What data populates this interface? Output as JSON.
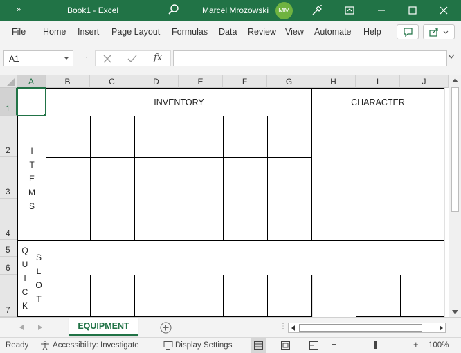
{
  "titlebar": {
    "quick_access": "»",
    "title": "Book1  -  Excel",
    "user_name": "Marcel Mrozowski",
    "user_initials": "MM",
    "bg_color": "#217346"
  },
  "menu": {
    "items": [
      "File",
      "Home",
      "Insert",
      "Page Layout",
      "Formulas",
      "Data",
      "Review",
      "View",
      "Automate",
      "Help"
    ]
  },
  "formula_bar": {
    "name_box": "A1",
    "formula": "",
    "fx": "fx"
  },
  "columns": [
    "A",
    "B",
    "C",
    "D",
    "E",
    "F",
    "G",
    "H",
    "I",
    "J"
  ],
  "rows": [
    "1",
    "2",
    "3",
    "4",
    "5",
    "6",
    "7"
  ],
  "sheet": {
    "inventory_label": "INVENTORY",
    "character_label": "CHARACTER",
    "items_letters": [
      "I",
      "T",
      "E",
      "M",
      "S"
    ],
    "quick_letters": [
      "Q",
      "U",
      "I",
      "C",
      "K"
    ],
    "slot_letters": [
      "S",
      "L",
      "O",
      "T"
    ]
  },
  "tabs": {
    "active": "EQUIPMENT",
    "accent": "#217346"
  },
  "status": {
    "ready": "Ready",
    "accessibility": "Accessibility: Investigate",
    "display_settings": "Display Settings",
    "zoom": "100%"
  }
}
